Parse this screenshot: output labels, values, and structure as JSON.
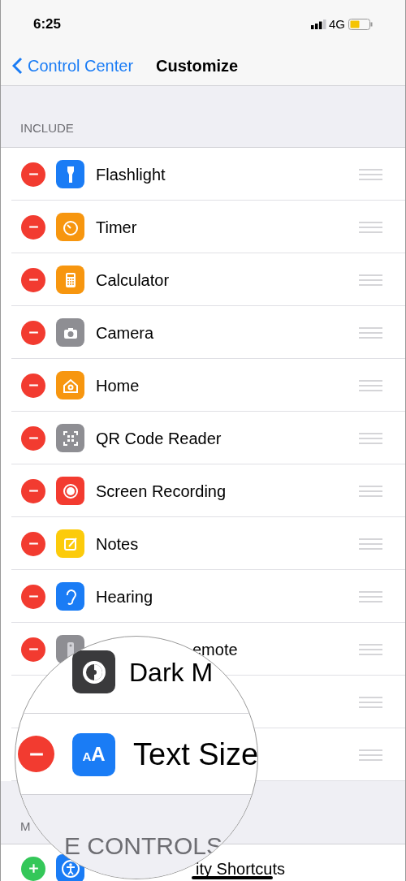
{
  "status_bar": {
    "time": "6:25",
    "network": "4G"
  },
  "nav": {
    "back": "Control Center",
    "title": "Customize"
  },
  "include": {
    "header": "INCLUDE",
    "rows": [
      {
        "kind": "full",
        "label": "Flashlight",
        "color": "#1a7cf5"
      },
      {
        "kind": "full",
        "label": "Timer",
        "color": "#f7960f"
      },
      {
        "kind": "full",
        "label": "Calculator",
        "color": "#f7960f"
      },
      {
        "kind": "full",
        "label": "Camera",
        "color": "#8e8e93"
      },
      {
        "kind": "full",
        "label": "Home",
        "color": "#f7960f"
      },
      {
        "kind": "full",
        "label": "QR Code Reader",
        "color": "#8e8e93"
      },
      {
        "kind": "full",
        "label": "Screen Recording",
        "color": "#f33b30"
      },
      {
        "kind": "full",
        "label": "Notes",
        "color": "#fccb0b"
      },
      {
        "kind": "full",
        "label": "Hearing",
        "color": "#1a7cf5"
      },
      {
        "kind": "cut",
        "label": "emote",
        "color": "#8e8e93"
      },
      {
        "kind": "covered"
      },
      {
        "kind": "covered"
      }
    ]
  },
  "more": {
    "header": "M",
    "row": {
      "label": "ity Shortcuts",
      "color": "#1a7cf5"
    }
  },
  "magnifier": {
    "rows": [
      {
        "label": "Dark M",
        "color": "#3a3a3c"
      },
      {
        "label": "Text Size",
        "color": "#1a7cf5",
        "glyph": "AA"
      }
    ],
    "header": "E CONTROLS"
  }
}
